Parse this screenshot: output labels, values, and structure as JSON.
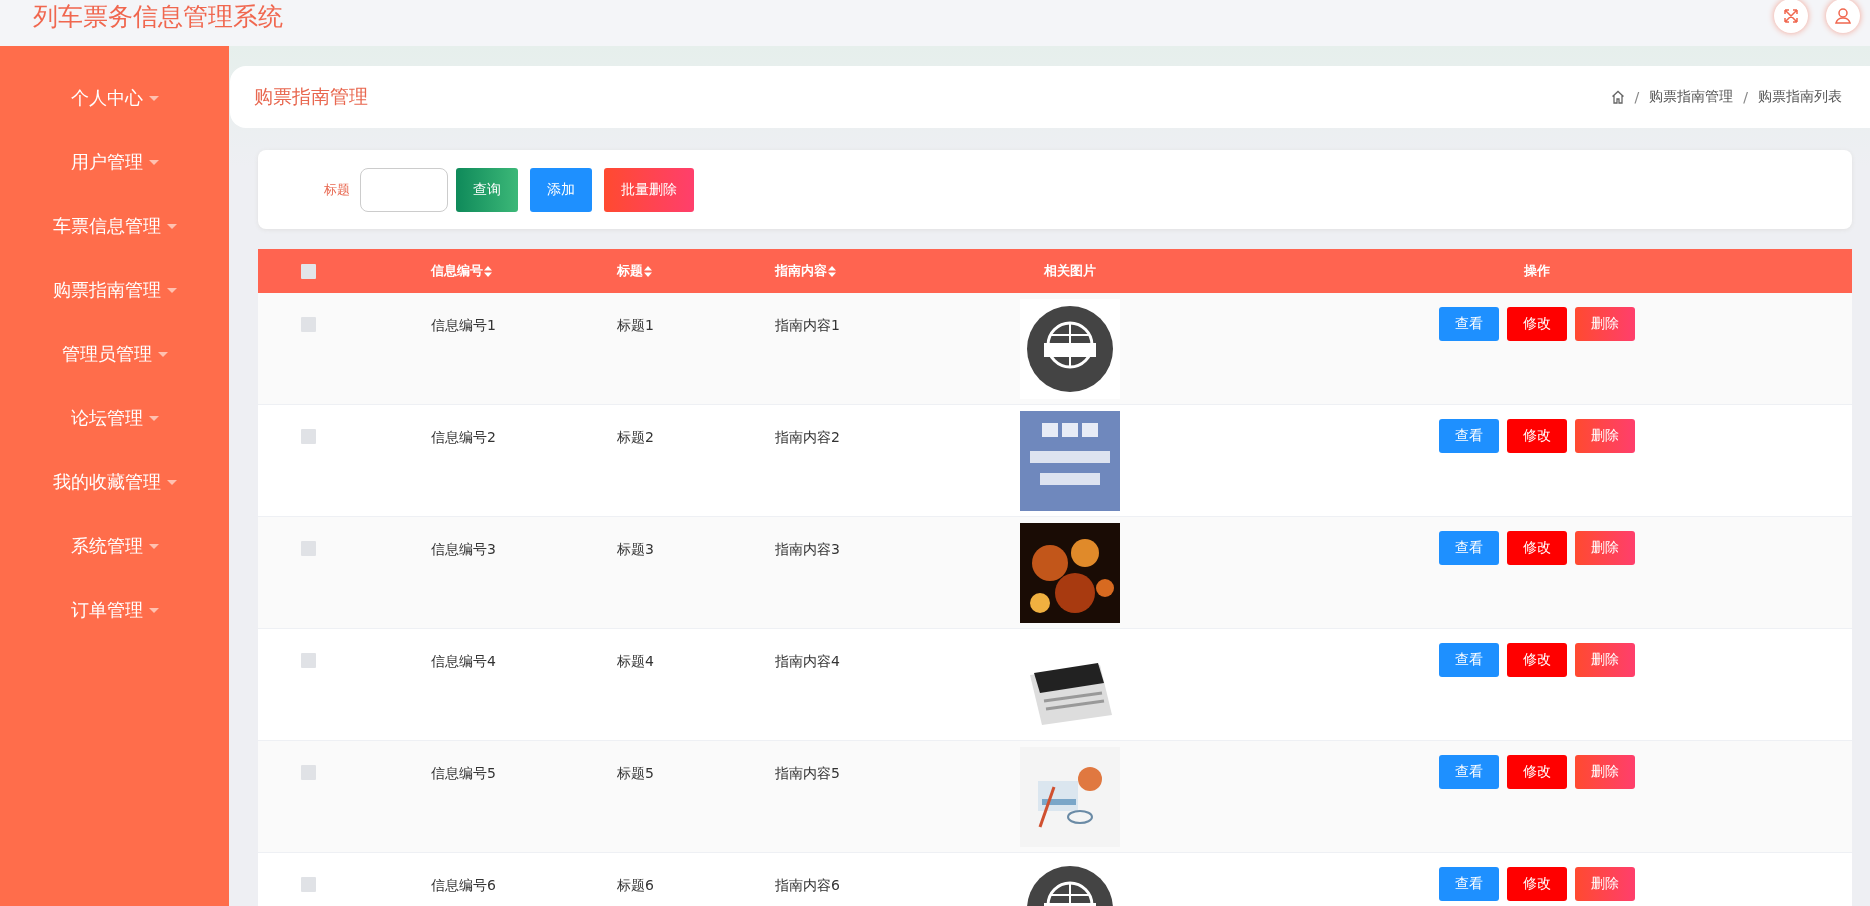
{
  "app_title": "列车票务信息管理系统",
  "sidebar": {
    "items": [
      {
        "label": "个人中心",
        "expandable": true
      },
      {
        "label": "用户管理",
        "expandable": true
      },
      {
        "label": "车票信息管理",
        "expandable": true
      },
      {
        "label": "购票指南管理",
        "expandable": true
      },
      {
        "label": "管理员管理",
        "expandable": true
      },
      {
        "label": "论坛管理",
        "expandable": true
      },
      {
        "label": "我的收藏管理",
        "expandable": true
      },
      {
        "label": "系统管理",
        "expandable": true
      },
      {
        "label": "订单管理",
        "expandable": true
      }
    ]
  },
  "page_header": {
    "title": "购票指南管理",
    "breadcrumb": [
      {
        "separator": "/",
        "label": "购票指南管理"
      },
      {
        "separator": "/",
        "label": "购票指南列表"
      }
    ]
  },
  "search": {
    "label": "标题"
  },
  "toolbar_buttons": [
    {
      "label": "查询",
      "kind": "search"
    },
    {
      "label": "添加",
      "kind": "add"
    },
    {
      "label": "批量删除",
      "kind": "delete"
    }
  ],
  "table": {
    "select_all_checked": false,
    "columns": [
      {
        "label": "信息编号",
        "sortable": true
      },
      {
        "label": "标题",
        "sortable": true
      },
      {
        "label": "指南内容",
        "sortable": true
      },
      {
        "label": "相关图片",
        "sortable": false
      },
      {
        "label": "操作",
        "sortable": false
      }
    ],
    "rows": [
      {
        "checked": false,
        "id": "信息编号1",
        "title": "标题1",
        "content": "指南内容1",
        "actions": [
          {
            "label": "查看",
            "kind": "view"
          },
          {
            "label": "修改",
            "kind": "edit"
          },
          {
            "label": "删除",
            "kind": "delete"
          }
        ]
      },
      {
        "checked": false,
        "id": "信息编号2",
        "title": "标题2",
        "content": "指南内容2",
        "actions": [
          {
            "label": "查看",
            "kind": "view"
          },
          {
            "label": "修改",
            "kind": "edit"
          },
          {
            "label": "删除",
            "kind": "delete"
          }
        ]
      },
      {
        "checked": false,
        "id": "信息编号3",
        "title": "标题3",
        "content": "指南内容3",
        "actions": [
          {
            "label": "查看",
            "kind": "view"
          },
          {
            "label": "修改",
            "kind": "edit"
          },
          {
            "label": "删除",
            "kind": "delete"
          }
        ]
      },
      {
        "checked": false,
        "id": "信息编号4",
        "title": "标题4",
        "content": "指南内容4",
        "actions": [
          {
            "label": "查看",
            "kind": "view"
          },
          {
            "label": "修改",
            "kind": "edit"
          },
          {
            "label": "删除",
            "kind": "delete"
          }
        ]
      },
      {
        "checked": false,
        "id": "信息编号5",
        "title": "标题5",
        "content": "指南内容5",
        "actions": [
          {
            "label": "查看",
            "kind": "view"
          },
          {
            "label": "修改",
            "kind": "edit"
          },
          {
            "label": "删除",
            "kind": "delete"
          }
        ]
      },
      {
        "checked": false,
        "id": "信息编号6",
        "title": "标题6",
        "content": "指南内容6",
        "actions": [
          {
            "label": "查看",
            "kind": "view"
          },
          {
            "label": "修改",
            "kind": "edit"
          },
          {
            "label": "删除",
            "kind": "delete"
          }
        ]
      }
    ]
  }
}
